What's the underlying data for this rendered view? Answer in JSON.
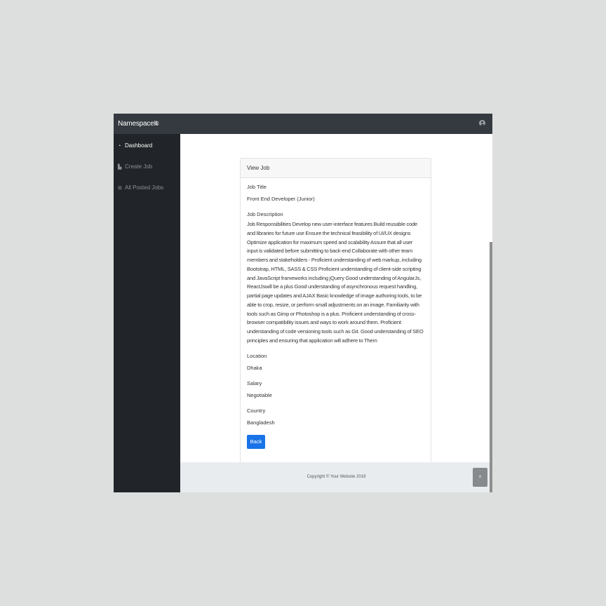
{
  "topbar": {
    "brand": "NamespaceIt",
    "menu_icon": "≡",
    "user_icon": "user-circle-icon"
  },
  "sidebar": {
    "items": [
      {
        "icon": "tachometer-icon",
        "glyph": "◔",
        "label": "Dashboard",
        "active": true
      },
      {
        "icon": "area-chart-icon",
        "glyph": "▙",
        "label": "Create Job",
        "active": false
      },
      {
        "icon": "table-icon",
        "glyph": "⊞",
        "label": "All Posted Jobs",
        "active": false
      }
    ]
  },
  "card": {
    "header": "View Job",
    "job_title_label": "Job Title",
    "job_title": "Front End Developer (Junior)",
    "job_description_label": "Job Description",
    "job_description": "Job Responsibilities Develop new user-interface features Build reusable code and libraries for future use Ensure the technical feasibility of UI/UX designs Optimize application for maximum speed and scalability Assure that all user input is validated before submitting to back-end Collaborate with other team members and stakeholders - Proficient understanding of web markup, including Bootstrap, HTML, SASS & CSS Proficient understanding of client-side scripting and JavaScript frameworks including jQuery Good understanding of AngularJs, ReactJswill be a plus Good understanding of asynchronous request handling, partial page updates and AJAX Basic knowledge of image authoring tools, to be able to crop, resize, or perform small adjustments on an image. Familiarity with tools such as Gimp or Photoshop is a plus. Proficient understanding of cross-browser compatibility issues and ways to work around them. Proficient understanding of code versioning tools such as Git. Good understanding of SEO principles and ensuring that application will adhere to Them",
    "location_label": "Location",
    "location": "Dhaka",
    "salary_label": "Salary",
    "salary": "Negotiable",
    "country_label": "Country",
    "country": "Bangladesh",
    "back_label": "Back"
  },
  "footer": {
    "copyright": "Copyright © Your Website 2019"
  },
  "scroll_to_top": {
    "icon": "chevron-up-icon",
    "glyph": "˄"
  },
  "colors": {
    "topbar": "#343a40",
    "sidebar": "#212529",
    "primary_button": "#1a73e8",
    "footer": "#e9ecef"
  }
}
